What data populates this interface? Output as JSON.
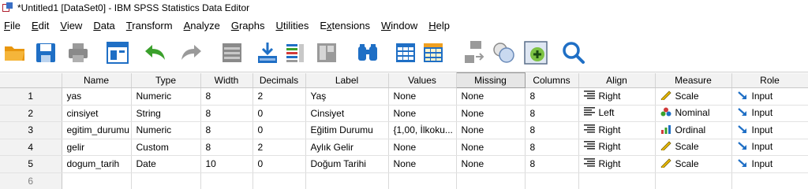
{
  "window": {
    "title": "*Untitled1 [DataSet0] - IBM SPSS Statistics Data Editor"
  },
  "menu": [
    {
      "label": "File",
      "mnemonic": "F",
      "rest": "ile"
    },
    {
      "label": "Edit",
      "mnemonic": "E",
      "rest": "dit"
    },
    {
      "label": "View",
      "mnemonic": "V",
      "rest": "iew"
    },
    {
      "label": "Data",
      "mnemonic": "D",
      "rest": "ata"
    },
    {
      "label": "Transform",
      "mnemonic": "T",
      "rest": "ransform"
    },
    {
      "label": "Analyze",
      "mnemonic": "A",
      "rest": "nalyze"
    },
    {
      "label": "Graphs",
      "mnemonic": "G",
      "rest": "raphs"
    },
    {
      "label": "Utilities",
      "mnemonic": "U",
      "rest": "tilities"
    },
    {
      "label": "Extensions",
      "mnemonic": "x",
      "prefix": "E",
      "rest": "tensions"
    },
    {
      "label": "Window",
      "mnemonic": "W",
      "rest": "indow"
    },
    {
      "label": "Help",
      "mnemonic": "H",
      "rest": "elp"
    }
  ],
  "toolbar": [
    {
      "icon": "open-folder-icon"
    },
    {
      "icon": "save-icon"
    },
    {
      "icon": "print-icon"
    },
    {
      "icon": "recall-dialog-icon"
    },
    {
      "icon": "undo-icon"
    },
    {
      "icon": "redo-icon"
    },
    {
      "icon": "goto-case-icon"
    },
    {
      "icon": "goto-variable-icon"
    },
    {
      "icon": "variables-icon"
    },
    {
      "icon": "run-descriptives-icon"
    },
    {
      "icon": "find-icon"
    },
    {
      "icon": "insert-cases-icon"
    },
    {
      "icon": "insert-variable-icon"
    },
    {
      "icon": "split-file-icon"
    },
    {
      "icon": "weight-cases-icon"
    },
    {
      "icon": "select-cases-icon"
    },
    {
      "icon": "value-labels-icon"
    },
    {
      "icon": "search-icon"
    }
  ],
  "accent": {
    "blue": "#1f6fc5",
    "green": "#3ba02c",
    "orange": "#f0a020"
  },
  "columns": [
    "Name",
    "Type",
    "Width",
    "Decimals",
    "Label",
    "Values",
    "Missing",
    "Columns",
    "Align",
    "Measure",
    "Role"
  ],
  "selected_column": "Missing",
  "rows": [
    {
      "n": "1",
      "name": "yas",
      "type": "Numeric",
      "width": "8",
      "decimals": "2",
      "label": "Yaş",
      "values": "None",
      "missing": "None",
      "columns": "8",
      "align": "Right",
      "align_icon": "align-right-icon",
      "measure": "Scale",
      "measure_icon": "scale-ruler-icon",
      "role": "Input",
      "role_icon": "input-arrow-icon"
    },
    {
      "n": "2",
      "name": "cinsiyet",
      "type": "String",
      "width": "8",
      "decimals": "0",
      "label": "Cinsiyet",
      "values": "None",
      "missing": "None",
      "columns": "8",
      "align": "Left",
      "align_icon": "align-left-icon",
      "measure": "Nominal",
      "measure_icon": "nominal-circles-icon",
      "role": "Input",
      "role_icon": "input-arrow-icon"
    },
    {
      "n": "3",
      "name": "egitim_durumu",
      "type": "Numeric",
      "width": "8",
      "decimals": "0",
      "label": "Eğitim Durumu",
      "values": "{1,00, İlkoku...",
      "missing": "None",
      "columns": "8",
      "align": "Right",
      "align_icon": "align-right-icon",
      "measure": "Ordinal",
      "measure_icon": "ordinal-bars-icon",
      "role": "Input",
      "role_icon": "input-arrow-icon"
    },
    {
      "n": "4",
      "name": "gelir",
      "type": "Custom",
      "width": "8",
      "decimals": "2",
      "label": "Aylık Gelir",
      "values": "None",
      "missing": "None",
      "columns": "8",
      "align": "Right",
      "align_icon": "align-right-icon",
      "measure": "Scale",
      "measure_icon": "scale-ruler-icon",
      "role": "Input",
      "role_icon": "input-arrow-icon"
    },
    {
      "n": "5",
      "name": "dogum_tarih",
      "type": "Date",
      "width": "10",
      "decimals": "0",
      "label": "Doğum Tarihi",
      "values": "None",
      "missing": "None",
      "columns": "8",
      "align": "Right",
      "align_icon": "align-right-icon",
      "measure": "Scale",
      "measure_icon": "scale-ruler-icon",
      "role": "Input",
      "role_icon": "input-arrow-icon"
    },
    {
      "n": "6",
      "name": "",
      "type": "",
      "width": "",
      "decimals": "",
      "label": "",
      "values": "",
      "missing": "",
      "columns": "",
      "align": "",
      "align_icon": "",
      "measure": "",
      "measure_icon": "",
      "role": "",
      "role_icon": ""
    }
  ]
}
